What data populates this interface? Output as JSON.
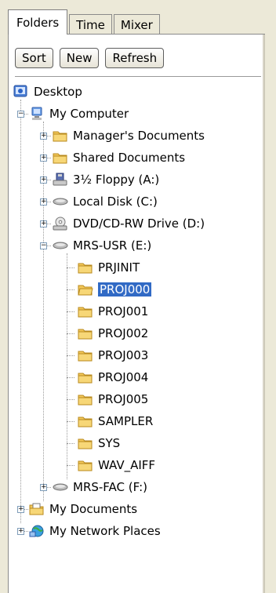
{
  "tabs": [
    {
      "label": "Folders",
      "active": true
    },
    {
      "label": "Time",
      "active": false
    },
    {
      "label": "Mixer",
      "active": false
    }
  ],
  "toolbar": {
    "sort_label": "Sort",
    "new_label": "New",
    "refresh_label": "Refresh"
  },
  "tree": {
    "desktop": "Desktop",
    "my_computer": "My Computer",
    "managers_documents": "Manager's Documents",
    "shared_documents": "Shared Documents",
    "floppy": "3½ Floppy (A:)",
    "local_disk": "Local Disk (C:)",
    "dvd": "DVD/CD-RW Drive (D:)",
    "mrs_usr": "MRS-USR (E:)",
    "folders": [
      "PRJINIT",
      "PROJ000",
      "PROJ001",
      "PROJ002",
      "PROJ003",
      "PROJ004",
      "PROJ005",
      "SAMPLER",
      "SYS",
      "WAV_AIFF"
    ],
    "selected_folder": "PROJ000",
    "mrs_fac": "MRS-FAC (F:)",
    "my_documents": "My Documents",
    "my_network_places": "My Network Places"
  },
  "colors": {
    "selection": "#316ac5",
    "folder": "#f3c85a"
  }
}
